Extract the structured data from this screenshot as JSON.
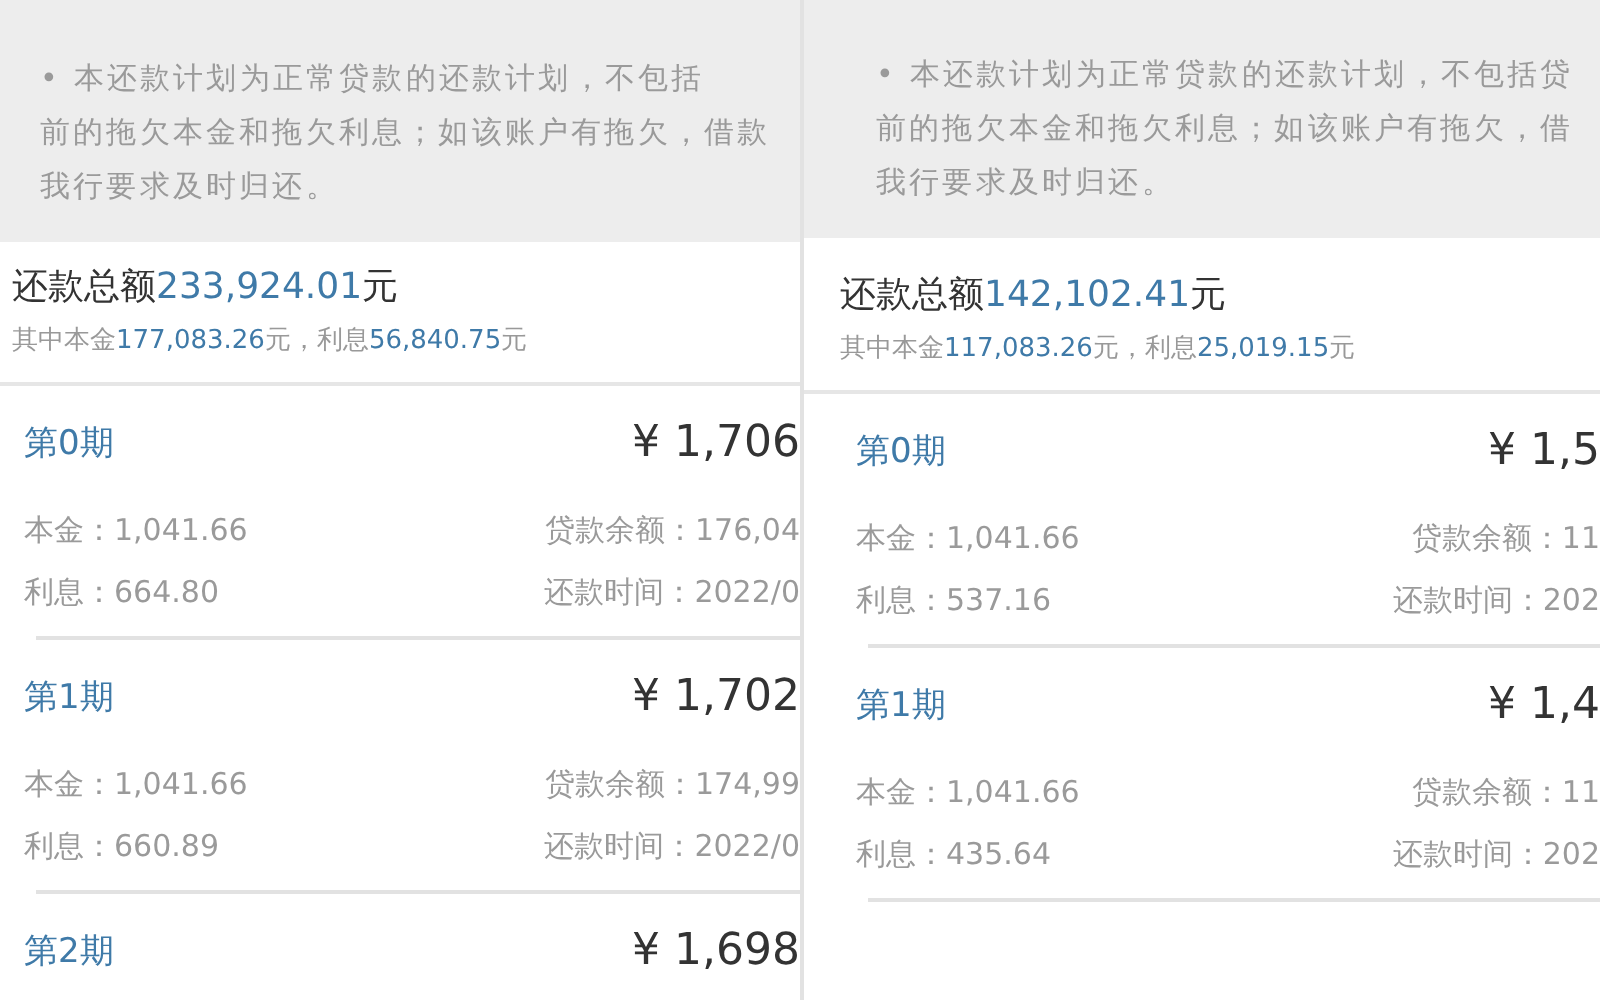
{
  "panels": [
    {
      "notice": [
        "• 本还款计划为正常贷款的还款计划，不包括",
        "前的拖欠本金和拖欠利息；如该账户有拖欠，借款",
        "我行要求及时归还。"
      ],
      "total": {
        "label": "还款总额",
        "amount": "233,924.01",
        "unit": "元"
      },
      "breakdown": {
        "principal_label": "其中本金",
        "principal": "177,083.26",
        "unit_1": "元，",
        "interest_label": "利息",
        "interest": "56,840.75",
        "unit_2": "元"
      },
      "installments": [
        {
          "period": "第0期",
          "amount": "¥ 1,706",
          "principal": "本金：1,041.66",
          "balance": "贷款余额：176,04",
          "interest": "利息：664.80",
          "due": "还款时间：2022/0"
        },
        {
          "period": "第1期",
          "amount": "¥ 1,702",
          "principal": "本金：1,041.66",
          "balance": "贷款余额：174,99",
          "interest": "利息：660.89",
          "due": "还款时间：2022/0"
        },
        {
          "period": "第2期",
          "amount": "¥ 1,698"
        }
      ]
    },
    {
      "notice": [
        "• 本还款计划为正常贷款的还款计划，不包括贷",
        "前的拖欠本金和拖欠利息；如该账户有拖欠，借",
        "我行要求及时归还。"
      ],
      "total": {
        "label": "还款总额",
        "amount": "142,102.41",
        "unit": "元"
      },
      "breakdown": {
        "principal_label": "其中本金",
        "principal": "117,083.26",
        "unit_1": "元，",
        "interest_label": "利息",
        "interest": "25,019.15",
        "unit_2": "元"
      },
      "installments": [
        {
          "period": "第0期",
          "amount": "¥ 1,5",
          "principal": "本金：1,041.66",
          "balance": "贷款余额：11",
          "interest": "利息：537.16",
          "due": "还款时间：202"
        },
        {
          "period": "第1期",
          "amount": "¥ 1,4",
          "principal": "本金：1,041.66",
          "balance": "贷款余额：11",
          "interest": "利息：435.64",
          "due": "还款时间：202"
        }
      ]
    }
  ]
}
